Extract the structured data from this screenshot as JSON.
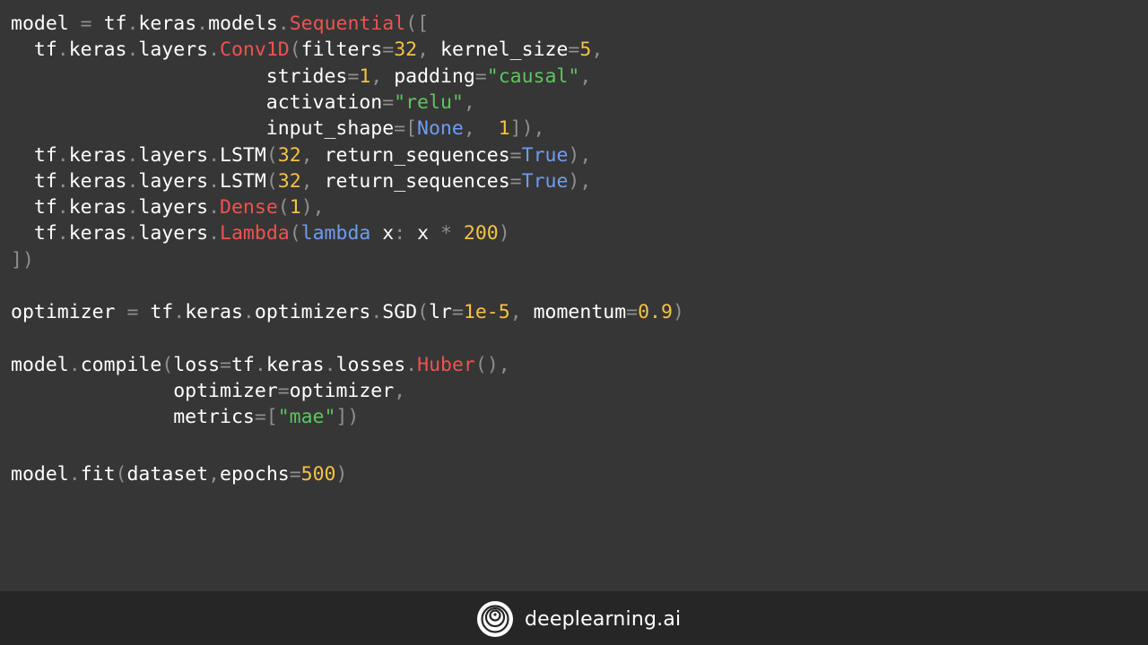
{
  "editor": {
    "colors": {
      "plain": "#ffffff",
      "punct": "#8f8f8f",
      "name": "#ef5350",
      "num": "#f5c342",
      "string": "#5fc45f",
      "keyword": "#6f9cf0"
    },
    "lines": [
      [
        {
          "t": "model",
          "c": "plain"
        },
        {
          "t": " = ",
          "c": "punct"
        },
        {
          "t": "tf",
          "c": "plain"
        },
        {
          "t": ".",
          "c": "punct"
        },
        {
          "t": "keras",
          "c": "plain"
        },
        {
          "t": ".",
          "c": "punct"
        },
        {
          "t": "models",
          "c": "plain"
        },
        {
          "t": ".",
          "c": "punct"
        },
        {
          "t": "Sequential",
          "c": "name"
        },
        {
          "t": "([",
          "c": "punct"
        }
      ],
      [
        {
          "t": "  tf",
          "c": "plain"
        },
        {
          "t": ".",
          "c": "punct"
        },
        {
          "t": "keras",
          "c": "plain"
        },
        {
          "t": ".",
          "c": "punct"
        },
        {
          "t": "layers",
          "c": "plain"
        },
        {
          "t": ".",
          "c": "punct"
        },
        {
          "t": "Conv1D",
          "c": "name"
        },
        {
          "t": "(",
          "c": "punct"
        },
        {
          "t": "filters",
          "c": "plain"
        },
        {
          "t": "=",
          "c": "punct"
        },
        {
          "t": "32",
          "c": "num"
        },
        {
          "t": ", ",
          "c": "punct"
        },
        {
          "t": "kernel_size",
          "c": "plain"
        },
        {
          "t": "=",
          "c": "punct"
        },
        {
          "t": "5",
          "c": "num"
        },
        {
          "t": ",",
          "c": "punct"
        }
      ],
      [
        {
          "t": "                      strides",
          "c": "plain"
        },
        {
          "t": "=",
          "c": "punct"
        },
        {
          "t": "1",
          "c": "num"
        },
        {
          "t": ", ",
          "c": "punct"
        },
        {
          "t": "padding",
          "c": "plain"
        },
        {
          "t": "=",
          "c": "punct"
        },
        {
          "t": "\"causal\"",
          "c": "string"
        },
        {
          "t": ",",
          "c": "punct"
        }
      ],
      [
        {
          "t": "                      activation",
          "c": "plain"
        },
        {
          "t": "=",
          "c": "punct"
        },
        {
          "t": "\"relu\"",
          "c": "string"
        },
        {
          "t": ",",
          "c": "punct"
        }
      ],
      [
        {
          "t": "                      input_shape",
          "c": "plain"
        },
        {
          "t": "=[",
          "c": "punct"
        },
        {
          "t": "None",
          "c": "keyword"
        },
        {
          "t": ",  ",
          "c": "punct"
        },
        {
          "t": "1",
          "c": "num"
        },
        {
          "t": "]),",
          "c": "punct"
        }
      ],
      [
        {
          "t": "  tf",
          "c": "plain"
        },
        {
          "t": ".",
          "c": "punct"
        },
        {
          "t": "keras",
          "c": "plain"
        },
        {
          "t": ".",
          "c": "punct"
        },
        {
          "t": "layers",
          "c": "plain"
        },
        {
          "t": ".",
          "c": "punct"
        },
        {
          "t": "LSTM",
          "c": "plain"
        },
        {
          "t": "(",
          "c": "punct"
        },
        {
          "t": "32",
          "c": "num"
        },
        {
          "t": ", ",
          "c": "punct"
        },
        {
          "t": "return_sequences",
          "c": "plain"
        },
        {
          "t": "=",
          "c": "punct"
        },
        {
          "t": "True",
          "c": "keyword"
        },
        {
          "t": "),",
          "c": "punct"
        }
      ],
      [
        {
          "t": "  tf",
          "c": "plain"
        },
        {
          "t": ".",
          "c": "punct"
        },
        {
          "t": "keras",
          "c": "plain"
        },
        {
          "t": ".",
          "c": "punct"
        },
        {
          "t": "layers",
          "c": "plain"
        },
        {
          "t": ".",
          "c": "punct"
        },
        {
          "t": "LSTM",
          "c": "plain"
        },
        {
          "t": "(",
          "c": "punct"
        },
        {
          "t": "32",
          "c": "num"
        },
        {
          "t": ", ",
          "c": "punct"
        },
        {
          "t": "return_sequences",
          "c": "plain"
        },
        {
          "t": "=",
          "c": "punct"
        },
        {
          "t": "True",
          "c": "keyword"
        },
        {
          "t": "),",
          "c": "punct"
        }
      ],
      [
        {
          "t": "  tf",
          "c": "plain"
        },
        {
          "t": ".",
          "c": "punct"
        },
        {
          "t": "keras",
          "c": "plain"
        },
        {
          "t": ".",
          "c": "punct"
        },
        {
          "t": "layers",
          "c": "plain"
        },
        {
          "t": ".",
          "c": "punct"
        },
        {
          "t": "Dense",
          "c": "name"
        },
        {
          "t": "(",
          "c": "punct"
        },
        {
          "t": "1",
          "c": "num"
        },
        {
          "t": "),",
          "c": "punct"
        }
      ],
      [
        {
          "t": "  tf",
          "c": "plain"
        },
        {
          "t": ".",
          "c": "punct"
        },
        {
          "t": "keras",
          "c": "plain"
        },
        {
          "t": ".",
          "c": "punct"
        },
        {
          "t": "layers",
          "c": "plain"
        },
        {
          "t": ".",
          "c": "punct"
        },
        {
          "t": "Lambda",
          "c": "name"
        },
        {
          "t": "(",
          "c": "punct"
        },
        {
          "t": "lambda",
          "c": "keyword"
        },
        {
          "t": " x",
          "c": "plain"
        },
        {
          "t": ": ",
          "c": "punct"
        },
        {
          "t": "x",
          "c": "plain"
        },
        {
          "t": " * ",
          "c": "punct"
        },
        {
          "t": "200",
          "c": "num"
        },
        {
          "t": ")",
          "c": "punct"
        }
      ],
      [
        {
          "t": "])",
          "c": "punct"
        }
      ],
      [
        {
          "t": "optimizer",
          "c": "plain"
        },
        {
          "t": " = ",
          "c": "punct"
        },
        {
          "t": "tf",
          "c": "plain"
        },
        {
          "t": ".",
          "c": "punct"
        },
        {
          "t": "keras",
          "c": "plain"
        },
        {
          "t": ".",
          "c": "punct"
        },
        {
          "t": "optimizers",
          "c": "plain"
        },
        {
          "t": ".",
          "c": "punct"
        },
        {
          "t": "SGD",
          "c": "plain"
        },
        {
          "t": "(",
          "c": "punct"
        },
        {
          "t": "lr",
          "c": "plain"
        },
        {
          "t": "=",
          "c": "punct"
        },
        {
          "t": "1e-5",
          "c": "num"
        },
        {
          "t": ", ",
          "c": "punct"
        },
        {
          "t": "momentum",
          "c": "plain"
        },
        {
          "t": "=",
          "c": "punct"
        },
        {
          "t": "0.9",
          "c": "num"
        },
        {
          "t": ")",
          "c": "punct"
        }
      ],
      [
        {
          "t": "model",
          "c": "plain"
        },
        {
          "t": ".",
          "c": "punct"
        },
        {
          "t": "compile",
          "c": "plain"
        },
        {
          "t": "(",
          "c": "punct"
        },
        {
          "t": "loss",
          "c": "plain"
        },
        {
          "t": "=",
          "c": "punct"
        },
        {
          "t": "tf",
          "c": "plain"
        },
        {
          "t": ".",
          "c": "punct"
        },
        {
          "t": "keras",
          "c": "plain"
        },
        {
          "t": ".",
          "c": "punct"
        },
        {
          "t": "losses",
          "c": "plain"
        },
        {
          "t": ".",
          "c": "punct"
        },
        {
          "t": "Huber",
          "c": "name"
        },
        {
          "t": "(),",
          "c": "punct"
        }
      ],
      [
        {
          "t": "              optimizer",
          "c": "plain"
        },
        {
          "t": "=",
          "c": "punct"
        },
        {
          "t": "optimizer",
          "c": "plain"
        },
        {
          "t": ",",
          "c": "punct"
        }
      ],
      [
        {
          "t": "              metrics",
          "c": "plain"
        },
        {
          "t": "=[",
          "c": "punct"
        },
        {
          "t": "\"mae\"",
          "c": "string"
        },
        {
          "t": "])",
          "c": "punct"
        }
      ],
      [
        {
          "t": "model",
          "c": "plain"
        },
        {
          "t": ".",
          "c": "punct"
        },
        {
          "t": "fit",
          "c": "plain"
        },
        {
          "t": "(",
          "c": "punct"
        },
        {
          "t": "dataset",
          "c": "plain"
        },
        {
          "t": ",",
          "c": "punct"
        },
        {
          "t": "epochs",
          "c": "plain"
        },
        {
          "t": "=",
          "c": "punct"
        },
        {
          "t": "500",
          "c": "num"
        },
        {
          "t": ")",
          "c": "punct"
        }
      ]
    ]
  },
  "footer": {
    "brand_text": "deeplearning.ai",
    "logo_icon": "deeplearning-logo-icon"
  }
}
